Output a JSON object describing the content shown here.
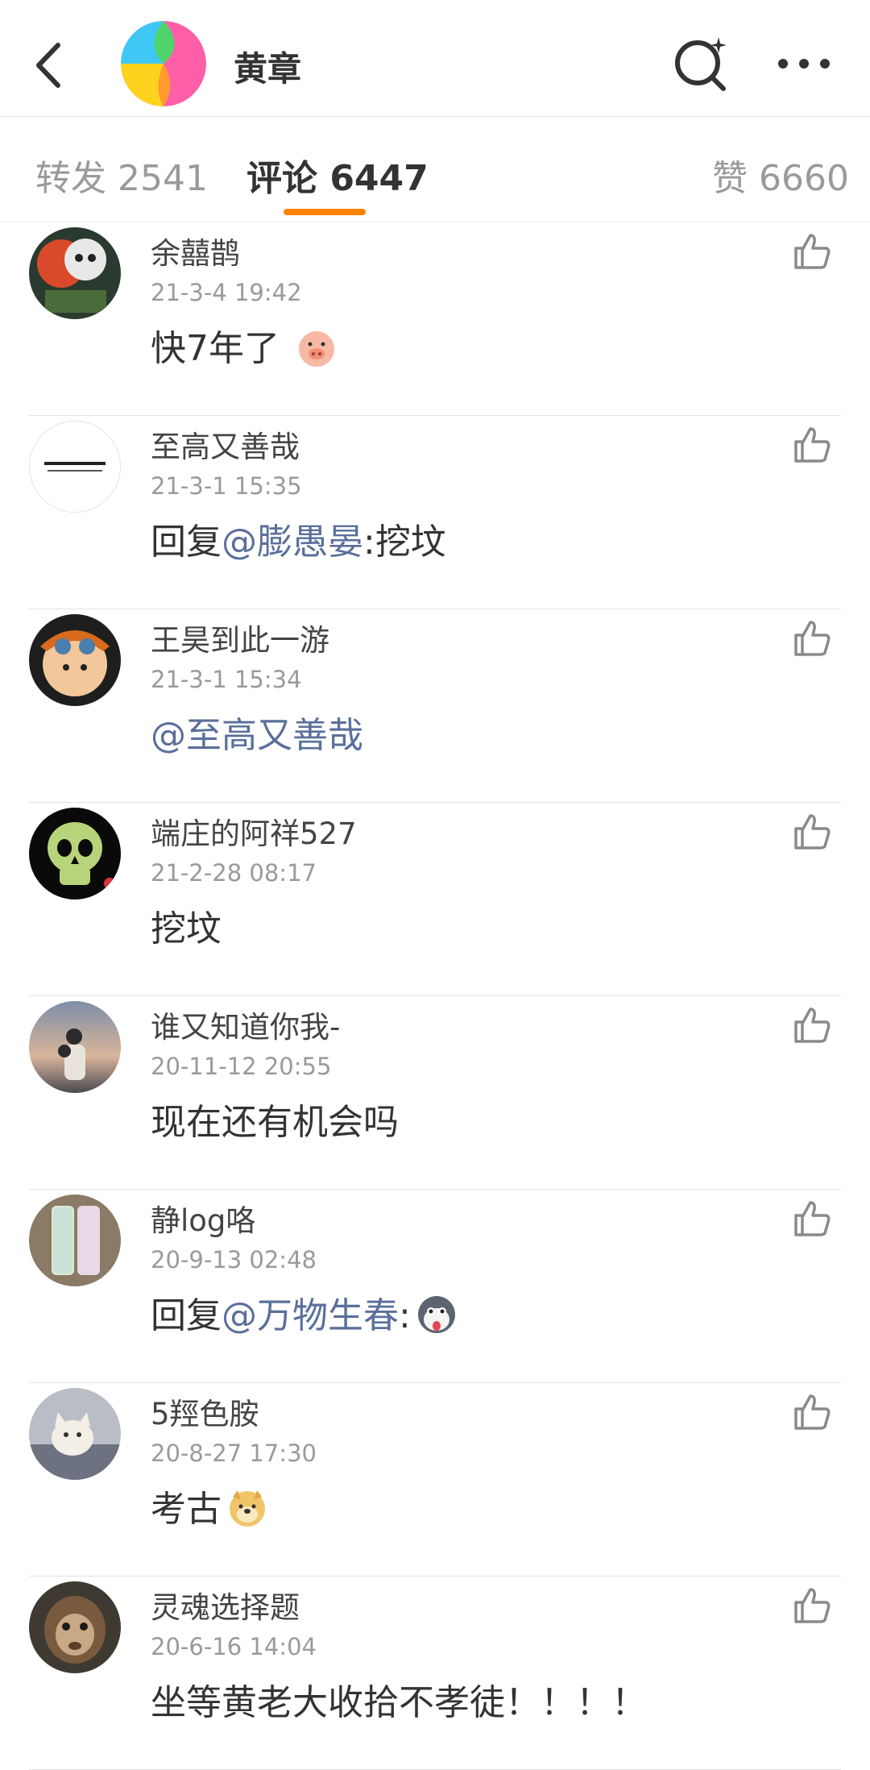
{
  "header": {
    "title": "黄章"
  },
  "tabs": {
    "reposts": "转发 2541",
    "comments": "评论 6447",
    "likes": "赞 6660"
  },
  "comments": [
    {
      "name": "余囍鹊",
      "time": "21-3-4 19:42",
      "text": "快7年了",
      "emoji": "pig-emoji"
    },
    {
      "name": "至高又善哉",
      "time": "21-3-1 15:35",
      "prefix": "回复",
      "mention": "@膨愚晏",
      "suffix": ":挖坟"
    },
    {
      "name": "王昊到此一游",
      "time": "21-3-1 15:34",
      "mention": "@至高又善哉"
    },
    {
      "name": "端庄的阿祥527",
      "time": "21-2-28 08:17",
      "text": "挖坟"
    },
    {
      "name": "谁又知道你我-",
      "time": "20-11-12 20:55",
      "text": "现在还有机会吗"
    },
    {
      "name": "静log咯",
      "time": "20-9-13 02:48",
      "prefix": "回复",
      "mention": "@万物生春",
      "suffix": ":",
      "emoji": "husky-emoji"
    },
    {
      "name": "5羥色胺",
      "time": "20-8-27 17:30",
      "text": "考古",
      "emoji": "doge-emoji"
    },
    {
      "name": "灵魂选择题",
      "time": "20-6-16 14:04",
      "text": "坐等黄老大收拾不孝徒！！！！"
    }
  ],
  "colors": {
    "accent": "#ff8200",
    "mention": "#5a6f9a"
  }
}
